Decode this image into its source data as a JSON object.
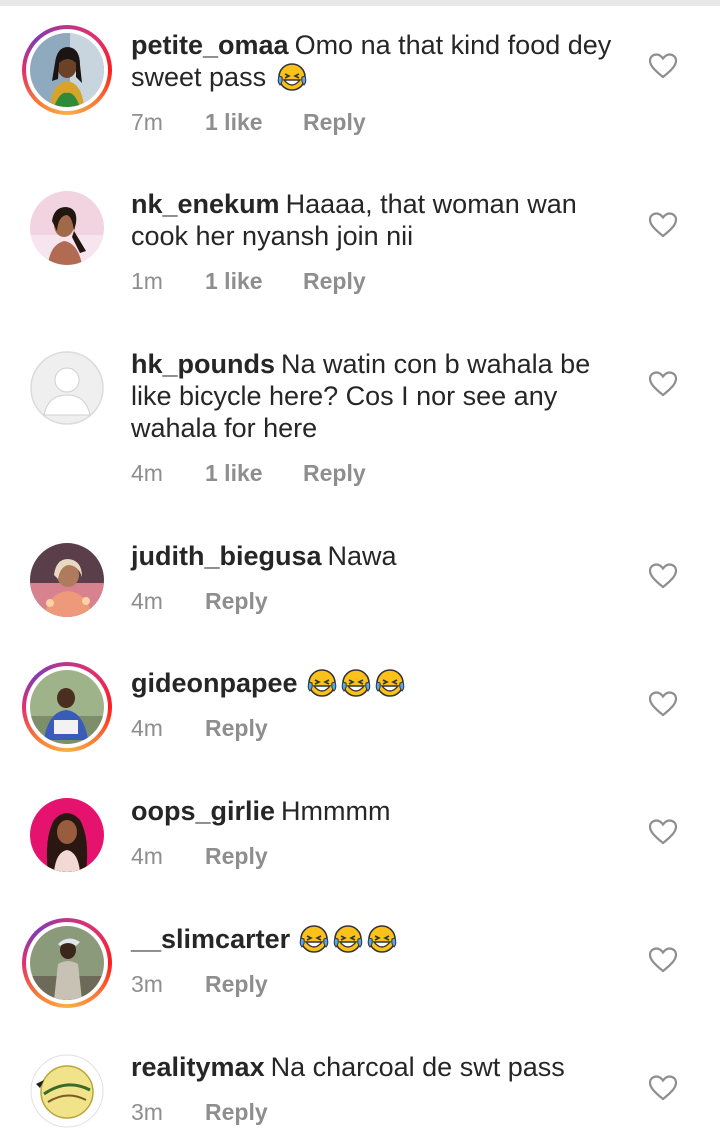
{
  "comments": [
    {
      "username": "petite_omaa",
      "text": "Omo na that kind food dey",
      "text2": "sweet pass",
      "time": "7m",
      "likes": "1 like",
      "reply": "Reply",
      "story_ring": true,
      "emoji_count": 1,
      "avatar": "woman-avatar"
    },
    {
      "username": "nk_enekum",
      "text": "Haaaa, that woman wan",
      "text2": "cook her nyansh join nii",
      "time": "1m",
      "likes": "1 like",
      "reply": "Reply",
      "story_ring": false,
      "emoji_count": 0,
      "avatar": "woman-avatar"
    },
    {
      "username": "hk_pounds",
      "text": "Na watin con b wahala be",
      "text2": "like bicycle here? Cos I nor see any",
      "text3": "wahala for here",
      "time": "4m",
      "likes": "1 like",
      "reply": "Reply",
      "story_ring": false,
      "emoji_count": 0,
      "avatar": "default-avatar"
    },
    {
      "username": "judith_biegusa",
      "text": "Nawa",
      "time": "4m",
      "reply": "Reply",
      "story_ring": false,
      "emoji_count": 0,
      "avatar": "woman-avatar"
    },
    {
      "username": "gideonpapee",
      "text": "",
      "time": "4m",
      "reply": "Reply",
      "story_ring": true,
      "emoji_count": 3,
      "avatar": "man-avatar"
    },
    {
      "username": "oops_girlie",
      "text": "Hmmmm",
      "time": "4m",
      "reply": "Reply",
      "story_ring": false,
      "emoji_count": 0,
      "avatar": "woman-avatar"
    },
    {
      "username": "__slimcarter",
      "text": "",
      "time": "3m",
      "reply": "Reply",
      "story_ring": true,
      "emoji_count": 3,
      "avatar": "man-avatar"
    },
    {
      "username": "realitymax",
      "text": "Na charcoal de swt pass",
      "time": "3m",
      "reply": "Reply",
      "story_ring": false,
      "emoji_count": 0,
      "avatar": "logo-avatar"
    }
  ],
  "icons": {
    "like": "heart-outline-icon",
    "emoji": "face-with-tears-of-joy"
  },
  "colors": {
    "text": "#262626",
    "meta": "#8e8e8e",
    "ring_start": "#fcaf45",
    "ring_end": "#c13584"
  }
}
